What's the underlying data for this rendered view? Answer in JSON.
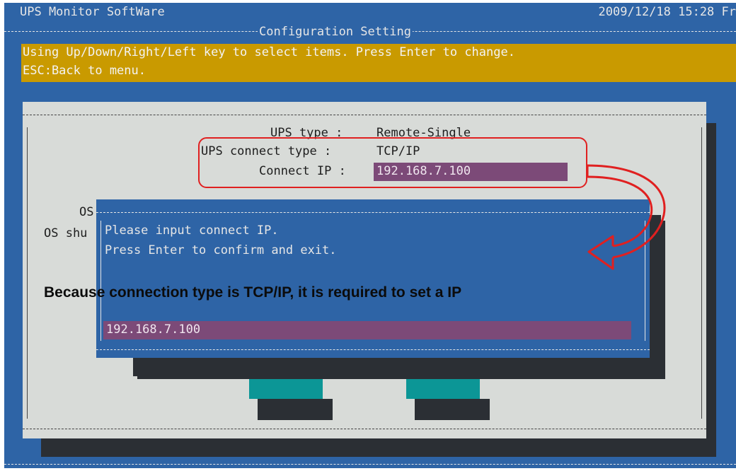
{
  "header": {
    "title": "UPS Monitor SoftWare",
    "datetime": "2009/12/18 15:28 Fr",
    "section": "Configuration Setting"
  },
  "help": {
    "line1": "Using Up/Down/Right/Left key to select items. Press Enter to change.",
    "line2": "ESC:Back to menu."
  },
  "config": {
    "rows": [
      {
        "label": "UPS type :",
        "value": "Remote-Single"
      },
      {
        "label": "UPS connect type :",
        "value": "TCP/IP"
      },
      {
        "label": "Connect IP :",
        "value": "192.168.7.100"
      }
    ],
    "partial_os": "OS",
    "partial_os_shu": "OS shu"
  },
  "dialog": {
    "line1": "Please input connect IP.",
    "line2": "Press Enter to confirm and exit.",
    "input_value": "192.168.7.100"
  },
  "annotation": {
    "text": "Because connection type is TCP/IP, it is required to set a IP"
  },
  "colors": {
    "screen_bg": "#2e64a6",
    "help_bar": "#c99a00",
    "panel_bg": "#d8dbd8",
    "field_bg": "#7c4a78",
    "button_bg": "#0c9696",
    "highlight_red": "#e02020"
  }
}
